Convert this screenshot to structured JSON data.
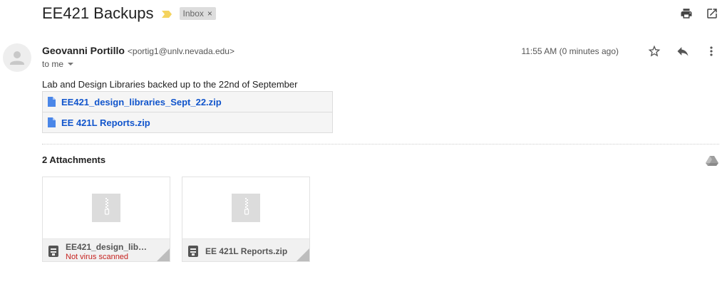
{
  "email": {
    "subject": "EE421 Backups",
    "label": "Inbox",
    "label_remove": "×"
  },
  "sender": {
    "name": "Geovanni Portillo",
    "email": "<portig1@unlv.nevada.edu>",
    "to": "to me",
    "timestamp": "11:55 AM (0 minutes ago)"
  },
  "body": {
    "text": "Lab and Design Libraries backed up to the 22nd of September",
    "links": [
      {
        "label": "EE421_design_libraries_Sept_22.zip"
      },
      {
        "label": "EE 421L Reports.zip"
      }
    ]
  },
  "attachments": {
    "title": "2 Attachments",
    "items": [
      {
        "name": "EE421_design_libra...",
        "warning": "Not virus scanned"
      },
      {
        "name": "EE 421L Reports.zip",
        "warning": ""
      }
    ]
  },
  "icons": {
    "print": "print-icon",
    "open_new_window": "open-in-new-window-icon",
    "star": "star-icon",
    "reply": "reply-icon",
    "more": "more-vert-icon",
    "drive": "google-drive-icon",
    "importance": "importance-marker-icon",
    "file": "file-icon",
    "zip": "zip-file-icon",
    "archive": "archive-type-icon"
  },
  "colors": {
    "link": "#1155cc",
    "importance": "#f4d35e",
    "warning": "#c5221f",
    "label_bg": "#dddddd"
  }
}
